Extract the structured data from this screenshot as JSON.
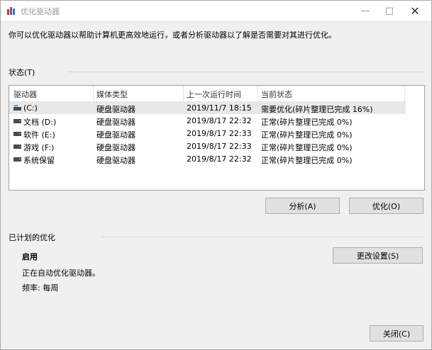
{
  "window": {
    "title": "优化驱动器"
  },
  "intro_text": "你可以优化驱动器以帮助计算机更高效地运行，或者分析驱动器以了解是否需要对其进行优化。",
  "status_group": {
    "label": "状态(T)"
  },
  "table": {
    "columns": [
      "驱动器",
      "媒体类型",
      "上一次运行时间",
      "当前状态"
    ],
    "rows": [
      {
        "drive": "(C:)",
        "media": "硬盘驱动器",
        "last_run": "2019/11/7 18:15",
        "status": "需要优化(碎片整理已完成 16%)",
        "icon": "system-drive-icon"
      },
      {
        "drive": "文档 (D:)",
        "media": "硬盘驱动器",
        "last_run": "2019/8/17 22:32",
        "status": "正常(碎片整理已完成 0%)",
        "icon": "drive-icon"
      },
      {
        "drive": "软件 (E:)",
        "media": "硬盘驱动器",
        "last_run": "2019/8/17 22:33",
        "status": "正常(碎片整理已完成 0%)",
        "icon": "drive-icon"
      },
      {
        "drive": "游戏 (F:)",
        "media": "硬盘驱动器",
        "last_run": "2019/8/17 22:33",
        "status": "正常(碎片整理已完成 0%)",
        "icon": "drive-icon"
      },
      {
        "drive": "系统保留",
        "media": "硬盘驱动器",
        "last_run": "2019/8/17 22:32",
        "status": "正常(碎片整理已完成 0%)",
        "icon": "drive-icon"
      }
    ]
  },
  "buttons": {
    "analyze": "分析(A)",
    "optimize": "优化(O)",
    "change_settings": "更改设置(S)",
    "close": "关闭(C)"
  },
  "scheduled": {
    "group_label": "已计划的优化",
    "title": "启用",
    "status": "正在自动优化驱动器。",
    "frequency": "频率: 每周"
  }
}
